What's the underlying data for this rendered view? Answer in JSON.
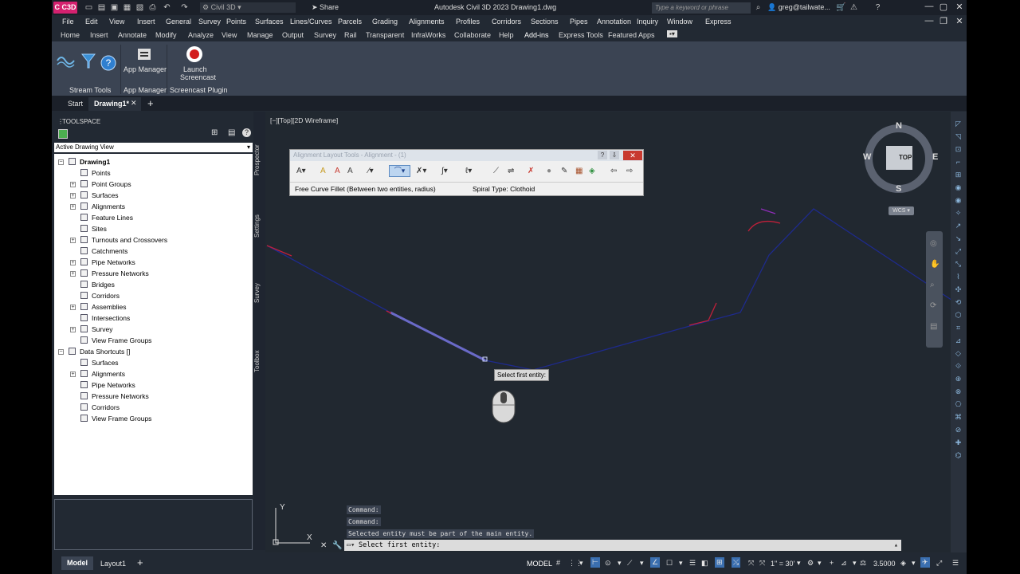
{
  "titlebar": {
    "logo_text": "C C3D",
    "workspace": "Civil 3D",
    "share": "Share",
    "app_title": "Autodesk Civil 3D 2023    Drawing1.dwg",
    "search_placeholder": "Type a keyword or phrase",
    "user": "greg@tailwate..."
  },
  "menubar": [
    "File",
    "Edit",
    "View",
    "Insert",
    "General",
    "Survey",
    "Points",
    "Surfaces",
    "Lines/Curves",
    "Parcels",
    "Grading",
    "Alignments",
    "Profiles",
    "Corridors",
    "Sections",
    "Pipes",
    "Annotation",
    "Inquiry",
    "Window",
    "Express"
  ],
  "ribbon_tabs": [
    "Home",
    "Insert",
    "Annotate",
    "Modify",
    "Analyze",
    "View",
    "Manage",
    "Output",
    "Survey",
    "Rail",
    "Transparent",
    "InfraWorks",
    "Collaborate",
    "Help",
    "Add-ins",
    "Express Tools",
    "Featured Apps"
  ],
  "ribbon": {
    "app_manager_label": "App Manager",
    "launch_label": "Launch",
    "screencast_label": "Screencast",
    "panel_stream": "Stream Tools",
    "panel_appmgr": "App Manager",
    "panel_screencast": "Screencast Plugin"
  },
  "filetabs": {
    "start": "Start",
    "drawing": "Drawing1*"
  },
  "toolspace": {
    "header": "TOOLSPACE",
    "view": "Active Drawing View",
    "tree": [
      {
        "label": "Drawing1",
        "bold": true
      },
      {
        "label": "Points"
      },
      {
        "label": "Point Groups"
      },
      {
        "label": "Surfaces"
      },
      {
        "label": "Alignments"
      },
      {
        "label": "Feature Lines"
      },
      {
        "label": "Sites"
      },
      {
        "label": "Turnouts and Crossovers"
      },
      {
        "label": "Catchments"
      },
      {
        "label": "Pipe Networks"
      },
      {
        "label": "Pressure Networks"
      },
      {
        "label": "Bridges"
      },
      {
        "label": "Corridors"
      },
      {
        "label": "Assemblies"
      },
      {
        "label": "Intersections"
      },
      {
        "label": "Survey"
      },
      {
        "label": "View Frame Groups"
      },
      {
        "label": "Data Shortcuts []"
      },
      {
        "label": "Surfaces"
      },
      {
        "label": "Alignments"
      },
      {
        "label": "Pipe Networks"
      },
      {
        "label": "Pressure Networks"
      },
      {
        "label": "Corridors"
      },
      {
        "label": "View Frame Groups"
      }
    ],
    "vtabs": [
      "Prospector",
      "Settings",
      "Survey",
      "Toolbox"
    ]
  },
  "viewport": {
    "control": "[−][Top][2D Wireframe]",
    "compass": {
      "n": "N",
      "s": "S",
      "e": "E",
      "w": "W",
      "top": "TOP",
      "wcs": "WCS"
    },
    "tooltip": "Select first entity:",
    "ucs_x": "X",
    "ucs_y": "Y"
  },
  "alignment_toolbar": {
    "title": "Alignment Layout Tools - Alignment - (1)",
    "status_left": "Free Curve Fillet (Between two entities, radius)",
    "status_right": "Spiral Type: Clothoid"
  },
  "command": {
    "history": [
      "Command:",
      "Command:",
      "Selected entity must be part of the main entity."
    ],
    "prompt": "Select first entity:"
  },
  "statusbar": {
    "model": "Model",
    "layout": "Layout1",
    "model_space": "MODEL",
    "scale": "1\" = 30'",
    "value": "3.5000"
  },
  "colors": {
    "background": "#212830",
    "alignment_line": "#1e2a8c",
    "curve_red": "#c0203a",
    "highlight": "#6a6ac8"
  }
}
